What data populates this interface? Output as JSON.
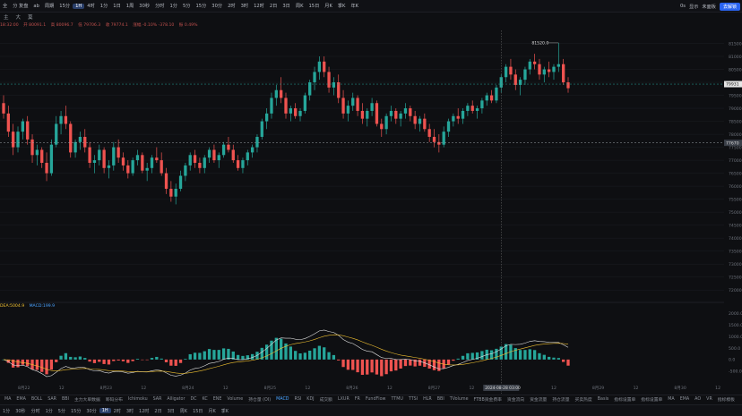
{
  "topbar": {
    "symbol": "全",
    "items": [
      {
        "label": "全",
        "active": false
      },
      {
        "label": "分 复盘",
        "active": false
      },
      {
        "label": "ab",
        "active": false
      },
      {
        "label": "周期",
        "active": false
      },
      {
        "label": "15分",
        "active": false
      },
      {
        "label": "1H",
        "active": true
      },
      {
        "label": "4时",
        "active": false
      },
      {
        "label": "1分",
        "active": false
      },
      {
        "label": "1日",
        "active": false
      },
      {
        "label": "1周",
        "active": false
      },
      {
        "label": "30秒",
        "active": false
      },
      {
        "label": "分时",
        "active": false
      },
      {
        "label": "1分",
        "active": false
      },
      {
        "label": "5分",
        "active": false
      },
      {
        "label": "15分",
        "active": false
      },
      {
        "label": "30分",
        "active": false
      },
      {
        "label": "2时",
        "active": false
      },
      {
        "label": "3时",
        "active": false
      },
      {
        "label": "12时",
        "active": false
      },
      {
        "label": "2日",
        "active": false
      },
      {
        "label": "3日",
        "active": false
      },
      {
        "label": "周K",
        "active": false
      },
      {
        "label": "15日",
        "active": false
      },
      {
        "label": "月K",
        "active": false
      },
      {
        "label": "季K",
        "active": false
      },
      {
        "label": "年K",
        "active": false
      }
    ],
    "right": [
      "0s",
      "显示",
      "未面板"
    ],
    "button": "去解锁"
  },
  "toolbar2": [
    "主",
    "大",
    "莫"
  ],
  "ohlc": {
    "time": "18:32:00",
    "open": "开 80091.1",
    "high": "高 80096.7",
    "low": "低 79706.3",
    "close": "收 79774.1",
    "change": "涨幅 -0.10% -378.10",
    "amp": "振 0.49%"
  },
  "colors": {
    "up": "#26a69a",
    "down": "#ef5350",
    "macd_line": "#e0e0e0",
    "signal_line": "#f0c030",
    "grid": "#1c1e24",
    "price_line_green": "#26a69a",
    "price_line_white": "#9aa0a8"
  },
  "chart_data": {
    "type": "candlestick",
    "price_axis": [
      "81500.0",
      "81000.0",
      "80500.0",
      "80000.0",
      "79500.0",
      "79000.0",
      "78500.0",
      "78000.0",
      "77500.0",
      "77000.0",
      "76500.0",
      "76000.0",
      "75500.0",
      "75000.0",
      "74500.0",
      "74000.0",
      "73500.0",
      "73000.0",
      "72500.0",
      "72000.0"
    ],
    "ylim": [
      71800,
      82000
    ],
    "max_label": "81520.0",
    "current_price": "79931",
    "marker_price": "77670",
    "x_labels": [
      "8月22",
      "12",
      "8月23",
      "12",
      "8月24",
      "12",
      "8月25",
      "12",
      "8月26",
      "12",
      "8月27",
      "12",
      "2024-08-28 03:00",
      "12",
      "8月29",
      "12",
      "8月30",
      "12"
    ],
    "candles": [
      [
        79200,
        79500,
        78600,
        78800
      ],
      [
        78800,
        79100,
        77900,
        78100
      ],
      [
        78100,
        78400,
        77200,
        77500
      ],
      [
        77500,
        78300,
        77300,
        78100
      ],
      [
        78100,
        78600,
        77800,
        78500
      ],
      [
        78500,
        78700,
        77600,
        77800
      ],
      [
        77800,
        78000,
        76900,
        77200
      ],
      [
        77200,
        77600,
        76800,
        77400
      ],
      [
        77400,
        77500,
        76700,
        76900
      ],
      [
        76900,
        77300,
        76200,
        76500
      ],
      [
        76500,
        77800,
        76400,
        77600
      ],
      [
        77600,
        78700,
        77500,
        78400
      ],
      [
        78400,
        78900,
        78000,
        78700
      ],
      [
        78700,
        79100,
        78200,
        78400
      ],
      [
        78400,
        78500,
        77100,
        77300
      ],
      [
        77300,
        77800,
        77100,
        77700
      ],
      [
        77700,
        78100,
        77400,
        77900
      ],
      [
        77900,
        78200,
        77300,
        77500
      ],
      [
        77500,
        77700,
        76700,
        76900
      ],
      [
        76900,
        77200,
        76500,
        77000
      ],
      [
        77000,
        77600,
        76800,
        77400
      ],
      [
        77400,
        77500,
        76500,
        76700
      ],
      [
        76700,
        77000,
        76300,
        76800
      ],
      [
        76800,
        77700,
        76600,
        77500
      ],
      [
        77500,
        77800,
        76900,
        77100
      ],
      [
        77100,
        77300,
        76600,
        76800
      ],
      [
        76800,
        77000,
        76300,
        76500
      ],
      [
        76500,
        77100,
        76400,
        77000
      ],
      [
        77000,
        77400,
        76800,
        77200
      ],
      [
        77200,
        77300,
        76500,
        76600
      ],
      [
        76600,
        76900,
        76200,
        76700
      ],
      [
        76700,
        77200,
        76500,
        77100
      ],
      [
        77100,
        77500,
        76900,
        77000
      ],
      [
        77000,
        77300,
        76400,
        76500
      ],
      [
        76500,
        76700,
        75700,
        75900
      ],
      [
        75900,
        76200,
        75400,
        75600
      ],
      [
        75600,
        76100,
        75300,
        75900
      ],
      [
        75900,
        76600,
        75800,
        76400
      ],
      [
        76400,
        76900,
        76200,
        76800
      ],
      [
        76800,
        77300,
        76600,
        77200
      ],
      [
        77200,
        77400,
        76700,
        76900
      ],
      [
        76900,
        77100,
        76500,
        76700
      ],
      [
        76700,
        77200,
        76500,
        77100
      ],
      [
        77100,
        77500,
        76900,
        77400
      ],
      [
        77400,
        77600,
        76900,
        77000
      ],
      [
        77000,
        77300,
        76700,
        77200
      ],
      [
        77200,
        77700,
        77100,
        77600
      ],
      [
        77600,
        77900,
        77300,
        77400
      ],
      [
        77400,
        77600,
        76900,
        77000
      ],
      [
        77000,
        77200,
        76600,
        76700
      ],
      [
        76700,
        77100,
        76500,
        77000
      ],
      [
        77000,
        77400,
        76800,
        77300
      ],
      [
        77300,
        77600,
        77100,
        77500
      ],
      [
        77500,
        78000,
        77300,
        77900
      ],
      [
        77900,
        78600,
        77800,
        78500
      ],
      [
        78500,
        79000,
        78200,
        78800
      ],
      [
        78800,
        79600,
        78600,
        79400
      ],
      [
        79400,
        79900,
        79100,
        79700
      ],
      [
        79700,
        80200,
        79200,
        79400
      ],
      [
        79400,
        79600,
        78600,
        78800
      ],
      [
        78800,
        79100,
        78500,
        79000
      ],
      [
        79000,
        79200,
        78600,
        78700
      ],
      [
        78700,
        79000,
        78500,
        78900
      ],
      [
        78900,
        79600,
        78800,
        79500
      ],
      [
        79500,
        80100,
        79300,
        80000
      ],
      [
        80000,
        80600,
        79700,
        80400
      ],
      [
        80400,
        81000,
        80100,
        80800
      ],
      [
        80800,
        81000,
        80200,
        80400
      ],
      [
        80400,
        80600,
        79600,
        79800
      ],
      [
        79800,
        80200,
        79500,
        80000
      ],
      [
        80000,
        80300,
        79200,
        79400
      ],
      [
        79400,
        79700,
        78600,
        78800
      ],
      [
        78800,
        79300,
        78500,
        79100
      ],
      [
        79100,
        79600,
        78900,
        79400
      ],
      [
        79400,
        79500,
        78700,
        78900
      ],
      [
        78900,
        79200,
        78400,
        78600
      ],
      [
        78600,
        79000,
        78300,
        78900
      ],
      [
        78900,
        79400,
        78700,
        79200
      ],
      [
        79200,
        79300,
        78300,
        78400
      ],
      [
        78400,
        78600,
        77900,
        78200
      ],
      [
        78200,
        78800,
        78000,
        78700
      ],
      [
        78700,
        79100,
        78500,
        78900
      ],
      [
        78900,
        79000,
        78400,
        78600
      ],
      [
        78600,
        78900,
        78300,
        78800
      ],
      [
        78800,
        79200,
        78600,
        79000
      ],
      [
        79000,
        79100,
        78500,
        78700
      ],
      [
        78700,
        78900,
        78200,
        78400
      ],
      [
        78400,
        78700,
        78100,
        78600
      ],
      [
        78600,
        78800,
        78100,
        78200
      ],
      [
        78200,
        78400,
        77700,
        77900
      ],
      [
        77900,
        78200,
        77500,
        77700
      ],
      [
        77700,
        78000,
        77300,
        77600
      ],
      [
        77600,
        78300,
        77500,
        78100
      ],
      [
        78100,
        78600,
        77900,
        78500
      ],
      [
        78500,
        78800,
        78300,
        78700
      ],
      [
        78700,
        79000,
        78400,
        78600
      ],
      [
        78600,
        79000,
        78400,
        78900
      ],
      [
        78900,
        79200,
        78700,
        79100
      ],
      [
        79100,
        79300,
        78800,
        78900
      ],
      [
        78900,
        79100,
        78600,
        79000
      ],
      [
        79000,
        79400,
        78800,
        79300
      ],
      [
        79300,
        79600,
        79100,
        79500
      ],
      [
        79500,
        79700,
        79200,
        79300
      ],
      [
        79300,
        79900,
        79200,
        79800
      ],
      [
        79800,
        80300,
        79600,
        80200
      ],
      [
        80200,
        80700,
        80000,
        80600
      ],
      [
        80600,
        80900,
        80100,
        80300
      ],
      [
        80300,
        80500,
        79700,
        79900
      ],
      [
        79900,
        80200,
        79500,
        80100
      ],
      [
        80100,
        80600,
        79900,
        80500
      ],
      [
        80500,
        80900,
        80300,
        80800
      ],
      [
        80800,
        81100,
        80500,
        80700
      ],
      [
        80700,
        80900,
        80100,
        80300
      ],
      [
        80300,
        80600,
        80000,
        80500
      ],
      [
        80500,
        80800,
        80200,
        80400
      ],
      [
        80400,
        80700,
        80100,
        80600
      ],
      [
        80600,
        81520,
        80400,
        80700
      ],
      [
        80700,
        80900,
        79900,
        80000
      ],
      [
        80000,
        80200,
        79600,
        79774
      ]
    ],
    "macd_axis": [
      "2000.0",
      "1500.0",
      "1000.0",
      "500.0",
      "0.0",
      "-500.0"
    ],
    "macd_ylim": [
      -700,
      2200
    ],
    "macd_legend": {
      "dif": "DEA:5004.9",
      "dea": "MACD:199.9"
    }
  },
  "bottom_indicators": [
    "MA",
    "EMA",
    "BOLL",
    "SAR",
    "BBI",
    "主力大单数据",
    "筹码分布",
    "Ichimoku",
    "SAR",
    "Alligator",
    "DC",
    "KC",
    "ENE",
    "Volume",
    "持仓量 (OI)",
    "MACD",
    "RSI",
    "KDJ",
    "成交额",
    "LXUR",
    "FR",
    "FundFlow",
    "TTMU",
    "TTSI",
    "HLR",
    "BBI",
    "TVolume",
    "FTBB资金费率",
    "资金流向",
    "资金流量",
    "持仓流量",
    "买卖热度",
    "Basis",
    "指标设置单",
    "指标设置单",
    "MA",
    "EMA",
    "AO",
    "VR",
    "指标模板"
  ],
  "tfbar": [
    "1分",
    "30秒",
    "分时",
    "1分",
    "5分",
    "15分",
    "30分",
    "1H",
    "2时",
    "3时",
    "12时",
    "2日",
    "3日",
    "周K",
    "15日",
    "月K",
    "季K"
  ],
  "crosshair_label": "2024-08-28 03:00"
}
